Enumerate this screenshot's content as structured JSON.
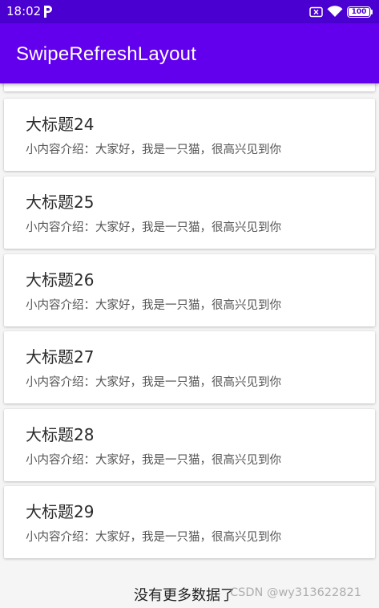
{
  "status_bar": {
    "time": "18:02",
    "battery_level": "100",
    "icons": [
      "parking-p-icon",
      "sim-card-x-icon",
      "wifi-icon",
      "battery-icon"
    ],
    "background": "#4a00d0"
  },
  "app_bar": {
    "title": "SwipeRefreshLayout",
    "background": "#6200ee"
  },
  "list": {
    "items": [
      {
        "title": "大标题24",
        "desc": "小内容介绍：大家好，我是一只猫，很高兴见到你"
      },
      {
        "title": "大标题25",
        "desc": "小内容介绍：大家好，我是一只猫，很高兴见到你"
      },
      {
        "title": "大标题26",
        "desc": "小内容介绍：大家好，我是一只猫，很高兴见到你"
      },
      {
        "title": "大标题27",
        "desc": "小内容介绍：大家好，我是一只猫，很高兴见到你"
      },
      {
        "title": "大标题28",
        "desc": "小内容介绍：大家好，我是一只猫，很高兴见到你"
      },
      {
        "title": "大标题29",
        "desc": "小内容介绍：大家好，我是一只猫，很高兴见到你"
      }
    ]
  },
  "footer": {
    "no_more_text": "没有更多数据了"
  },
  "watermark": {
    "text": "CSDN @wy313622821"
  }
}
